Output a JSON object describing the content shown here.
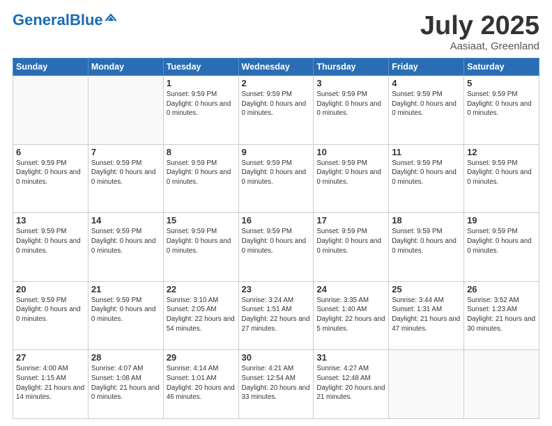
{
  "header": {
    "logo_main": "General",
    "logo_accent": "Blue",
    "title": "July 2025",
    "subtitle": "Aasiaat, Greenland"
  },
  "weekdays": [
    "Sunday",
    "Monday",
    "Tuesday",
    "Wednesday",
    "Thursday",
    "Friday",
    "Saturday"
  ],
  "weeks": [
    [
      {
        "day": "",
        "info": ""
      },
      {
        "day": "",
        "info": ""
      },
      {
        "day": "1",
        "info": "Sunset: 9:59 PM\nDaylight: 0 hours and 0 minutes."
      },
      {
        "day": "2",
        "info": "Sunset: 9:59 PM\nDaylight: 0 hours and 0 minutes."
      },
      {
        "day": "3",
        "info": "Sunset: 9:59 PM\nDaylight: 0 hours and 0 minutes."
      },
      {
        "day": "4",
        "info": "Sunset: 9:59 PM\nDaylight: 0 hours and 0 minutes."
      },
      {
        "day": "5",
        "info": "Sunset: 9:59 PM\nDaylight: 0 hours and 0 minutes."
      }
    ],
    [
      {
        "day": "6",
        "info": "Sunset: 9:59 PM\nDaylight: 0 hours and 0 minutes."
      },
      {
        "day": "7",
        "info": "Sunset: 9:59 PM\nDaylight: 0 hours and 0 minutes."
      },
      {
        "day": "8",
        "info": "Sunset: 9:59 PM\nDaylight: 0 hours and 0 minutes."
      },
      {
        "day": "9",
        "info": "Sunset: 9:59 PM\nDaylight: 0 hours and 0 minutes."
      },
      {
        "day": "10",
        "info": "Sunset: 9:59 PM\nDaylight: 0 hours and 0 minutes."
      },
      {
        "day": "11",
        "info": "Sunset: 9:59 PM\nDaylight: 0 hours and 0 minutes."
      },
      {
        "day": "12",
        "info": "Sunset: 9:59 PM\nDaylight: 0 hours and 0 minutes."
      }
    ],
    [
      {
        "day": "13",
        "info": "Sunset: 9:59 PM\nDaylight: 0 hours and 0 minutes."
      },
      {
        "day": "14",
        "info": "Sunset: 9:59 PM\nDaylight: 0 hours and 0 minutes."
      },
      {
        "day": "15",
        "info": "Sunset: 9:59 PM\nDaylight: 0 hours and 0 minutes."
      },
      {
        "day": "16",
        "info": "Sunset: 9:59 PM\nDaylight: 0 hours and 0 minutes."
      },
      {
        "day": "17",
        "info": "Sunset: 9:59 PM\nDaylight: 0 hours and 0 minutes."
      },
      {
        "day": "18",
        "info": "Sunset: 9:59 PM\nDaylight: 0 hours and 0 minutes."
      },
      {
        "day": "19",
        "info": "Sunset: 9:59 PM\nDaylight: 0 hours and 0 minutes."
      }
    ],
    [
      {
        "day": "20",
        "info": "Sunset: 9:59 PM\nDaylight: 0 hours and 0 minutes."
      },
      {
        "day": "21",
        "info": "Sunset: 9:59 PM\nDaylight: 0 hours and 0 minutes."
      },
      {
        "day": "22",
        "info": "Sunrise: 3:10 AM\nSunset: 2:05 AM\nDaylight: 22 hours and 54 minutes."
      },
      {
        "day": "23",
        "info": "Sunrise: 3:24 AM\nSunset: 1:51 AM\nDaylight: 22 hours and 27 minutes."
      },
      {
        "day": "24",
        "info": "Sunrise: 3:35 AM\nSunset: 1:40 AM\nDaylight: 22 hours and 5 minutes."
      },
      {
        "day": "25",
        "info": "Sunrise: 3:44 AM\nSunset: 1:31 AM\nDaylight: 21 hours and 47 minutes."
      },
      {
        "day": "26",
        "info": "Sunrise: 3:52 AM\nSunset: 1:23 AM\nDaylight: 21 hours and 30 minutes."
      }
    ],
    [
      {
        "day": "27",
        "info": "Sunrise: 4:00 AM\nSunset: 1:15 AM\nDaylight: 21 hours and 14 minutes."
      },
      {
        "day": "28",
        "info": "Sunrise: 4:07 AM\nSunset: 1:08 AM\nDaylight: 21 hours and 0 minutes."
      },
      {
        "day": "29",
        "info": "Sunrise: 4:14 AM\nSunset: 1:01 AM\nDaylight: 20 hours and 46 minutes."
      },
      {
        "day": "30",
        "info": "Sunrise: 4:21 AM\nSunset: 12:54 AM\nDaylight: 20 hours and 33 minutes."
      },
      {
        "day": "31",
        "info": "Sunrise: 4:27 AM\nSunset: 12:48 AM\nDaylight: 20 hours and 21 minutes."
      },
      {
        "day": "",
        "info": ""
      },
      {
        "day": "",
        "info": ""
      }
    ]
  ]
}
